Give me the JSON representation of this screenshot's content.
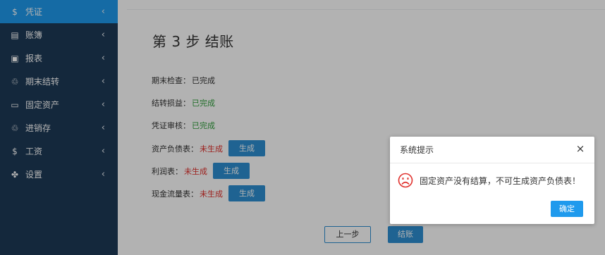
{
  "sidebar": {
    "items": [
      {
        "label": "凭证",
        "icon": "dollar-icon",
        "glyph": "$",
        "active": true
      },
      {
        "label": "账簿",
        "icon": "ledger-icon",
        "glyph": "▤"
      },
      {
        "label": "报表",
        "icon": "report-icon",
        "glyph": "▣"
      },
      {
        "label": "期末结转",
        "icon": "refresh-icon",
        "glyph": "♲"
      },
      {
        "label": "固定资产",
        "icon": "monitor-icon",
        "glyph": "▭"
      },
      {
        "label": "进销存",
        "icon": "cycle-icon",
        "glyph": "♲"
      },
      {
        "label": "工资",
        "icon": "salary-icon",
        "glyph": "$"
      },
      {
        "label": "设置",
        "icon": "settings-icon",
        "glyph": "✤"
      }
    ],
    "chevron": "‹"
  },
  "main": {
    "step_title": "第 3 步 结账",
    "checks": [
      {
        "label": "期末检查：",
        "value": "已完成",
        "status": "done-plain"
      },
      {
        "label": "结转损益：",
        "value": "已完成",
        "status": "done"
      },
      {
        "label": "凭证审核：",
        "value": "已完成",
        "status": "done"
      }
    ],
    "reports": [
      {
        "label": "资产负债表：",
        "value": "未生成",
        "button": "生成"
      },
      {
        "label": "利润表：",
        "value": "未生成",
        "button": "生成"
      },
      {
        "label": "现金流量表：",
        "value": "未生成",
        "button": "生成"
      }
    ],
    "prev_button": "上一步",
    "finish_button": "结账"
  },
  "dialog": {
    "title": "系统提示",
    "close_glyph": "×",
    "message": "固定资产没有结算，不可生成资产负债表！",
    "ok_button": "确定"
  },
  "colors": {
    "sidebar_bg": "#1e3a56",
    "active_item": "#1f9aed",
    "primary_button": "#2d8fd1",
    "success_text": "#2e9e3a",
    "error_text": "#e0302c",
    "sad_icon": "#e0302c"
  }
}
